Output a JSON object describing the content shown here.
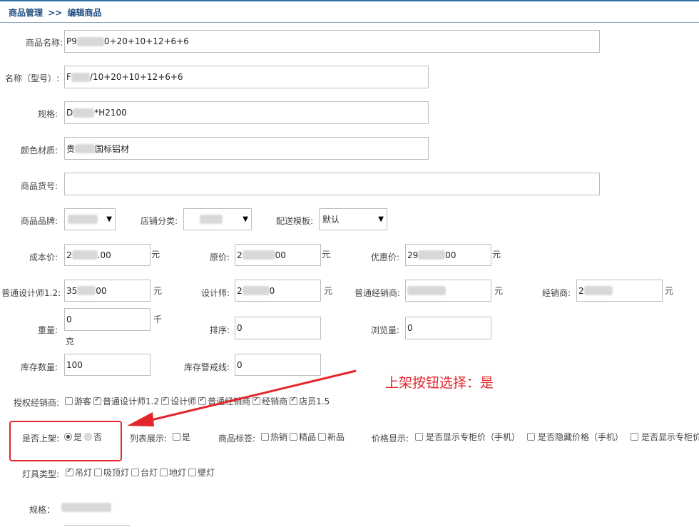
{
  "breadcrumb": {
    "root": "商品管理",
    "sep": ">>",
    "current": "编辑商品"
  },
  "fields": {
    "name": {
      "label": "商品名称:",
      "prefix": "P9",
      "suffix": "0+20+10+12+6+6"
    },
    "model": {
      "label": "名称（型号）:",
      "prefix": "F",
      "suffix": "/10+20+10+12+6+6"
    },
    "spec": {
      "label": "规格:",
      "prefix": "D",
      "suffix": "*H2100"
    },
    "material": {
      "label": "颜色材质:",
      "prefix": "贵",
      "suffix": "国标铝材"
    },
    "sku": {
      "label": "商品货号:",
      "value": ""
    },
    "brand": {
      "label": "商品品牌:"
    },
    "shop_category": {
      "label": "店铺分类:"
    },
    "shipping": {
      "label": "配送模板:",
      "value": "默认"
    },
    "cost": {
      "label": "成本价:",
      "prefix": "2",
      "suffix": ".00",
      "unit": "元"
    },
    "original": {
      "label": "原价:",
      "prefix": "2",
      "suffix": "00",
      "unit": "元"
    },
    "discount": {
      "label": "优惠价:",
      "prefix": "29",
      "suffix": "00",
      "unit": "元"
    },
    "designer12": {
      "label": "普通设计师1.2:",
      "prefix": "35",
      "suffix": "00",
      "unit": "元"
    },
    "designer": {
      "label": "设计师:",
      "prefix": "2",
      "suffix": "0",
      "unit": "元"
    },
    "dealer_normal": {
      "label": "普通经销商:",
      "unit": "元"
    },
    "dealer": {
      "label": "经销商:",
      "prefix": "2",
      "unit": "元"
    },
    "weight": {
      "label": "重量:",
      "value": "0",
      "unit1": "千",
      "unit2": "克"
    },
    "sort": {
      "label": "排序:",
      "value": "0"
    },
    "views": {
      "label": "浏览量:",
      "value": "0"
    },
    "stock": {
      "label": "库存数量:",
      "value": "100"
    },
    "stock_alert": {
      "label": "库存警戒线:",
      "value": "0"
    }
  },
  "authorized": {
    "label": "授权经销商:",
    "options": [
      {
        "text": "游客",
        "checked": false
      },
      {
        "text": "普通设计师1.2",
        "checked": true
      },
      {
        "text": "设计师",
        "checked": true
      },
      {
        "text": "普通经销商",
        "checked": true
      },
      {
        "text": "经销商",
        "checked": true
      },
      {
        "text": "店员1.5",
        "checked": true
      }
    ]
  },
  "on_shelf": {
    "label": "是否上架:",
    "yes": "是",
    "no": "否",
    "selected": "yes"
  },
  "list_show": {
    "label": "列表展示:",
    "option": "是"
  },
  "tags": {
    "label": "商品标签:",
    "options": [
      "热销",
      "精品",
      "新品"
    ]
  },
  "price_display": {
    "label": "价格显示:",
    "options": [
      "是否显示专柜价（手机）",
      "是否隐藏价格（手机）",
      "是否显示专柜价"
    ]
  },
  "lamp_type": {
    "label": "灯具类型:",
    "options": [
      {
        "text": "吊灯",
        "checked": true
      },
      {
        "text": "吸顶灯",
        "checked": false
      },
      {
        "text": "台灯",
        "checked": false
      },
      {
        "text": "地灯",
        "checked": false
      },
      {
        "text": "壁灯",
        "checked": false
      }
    ]
  },
  "spec_bottom": {
    "label": "规格："
  },
  "annotation": {
    "text": "上架按钮选择：是",
    "color": "#e3262c"
  }
}
